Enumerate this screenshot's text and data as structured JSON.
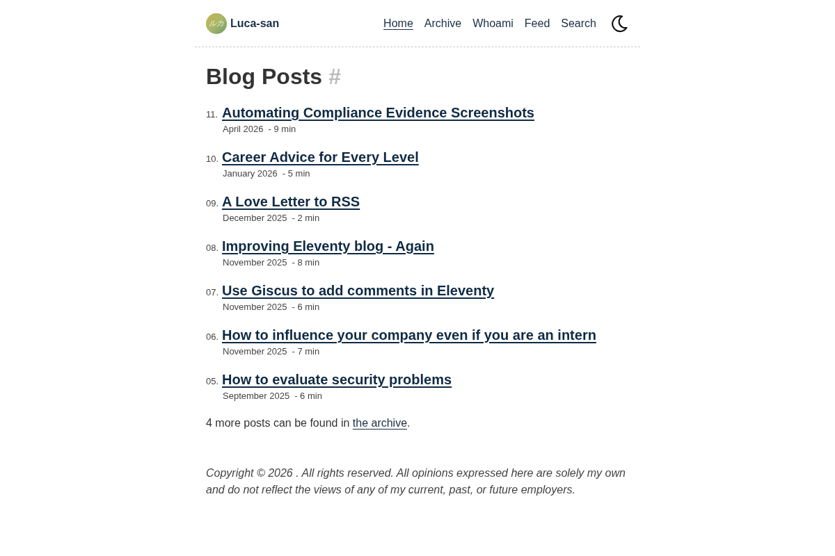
{
  "site": {
    "logo_text": "ルカ",
    "title": "Luca-san"
  },
  "nav": [
    {
      "label": "Home",
      "selected": true
    },
    {
      "label": "Archive",
      "selected": false
    },
    {
      "label": "Whoami",
      "selected": false
    },
    {
      "label": "Feed",
      "selected": false
    },
    {
      "label": "Search",
      "selected": false
    }
  ],
  "page": {
    "title": "Blog Posts",
    "anchor": "#"
  },
  "posts": [
    {
      "number": "11.",
      "title": "Automating Compliance Evidence Screenshots",
      "date": "April 2026",
      "read_time": "- 9 min"
    },
    {
      "number": "10.",
      "title": "Career Advice for Every Level",
      "date": "January 2026",
      "read_time": "- 5 min"
    },
    {
      "number": "09.",
      "title": "A Love Letter to RSS",
      "date": "December 2025",
      "read_time": "- 2 min"
    },
    {
      "number": "08.",
      "title": "Improving Eleventy blog - Again",
      "date": "November 2025",
      "read_time": "- 8 min"
    },
    {
      "number": "07.",
      "title": "Use Giscus to add comments in Eleventy",
      "date": "November 2025",
      "read_time": "- 6 min"
    },
    {
      "number": "06.",
      "title": "How to influence your company even if you are an intern",
      "date": "November 2025",
      "read_time": "- 7 min"
    },
    {
      "number": "05.",
      "title": "How to evaluate security problems",
      "date": "September 2025",
      "read_time": "- 6 min"
    }
  ],
  "more_posts": {
    "text_before": "4 more posts can be found in ",
    "link": "the archive",
    "text_after": "."
  },
  "footer": {
    "copyright": "Copyright © 2026 . All rights reserved. All opinions expressed here are solely my own and do not reflect the views of any of my current, past, or future employers."
  }
}
